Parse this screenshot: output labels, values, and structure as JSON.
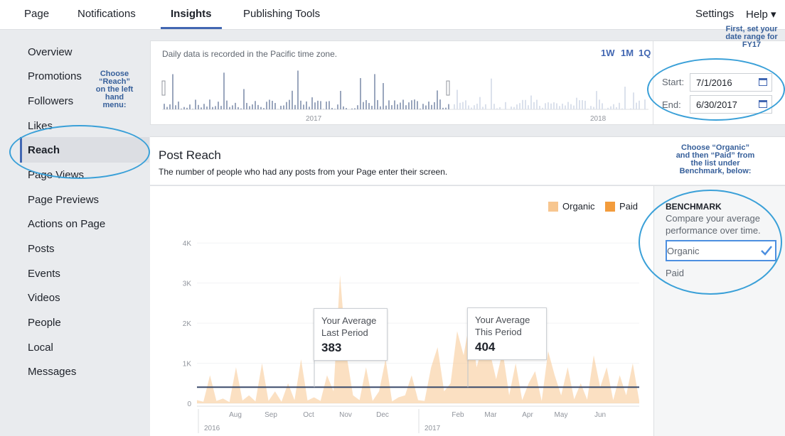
{
  "nav": {
    "page": "Page",
    "notifications": "Notifications",
    "insights": "Insights",
    "publishing_tools": "Publishing Tools",
    "settings": "Settings",
    "help": "Help ▾"
  },
  "sidebar": {
    "items": [
      "Overview",
      "Promotions",
      "Followers",
      "Likes",
      "Reach",
      "Page Views",
      "Page Previews",
      "Actions on Page",
      "Posts",
      "Events",
      "Videos",
      "People",
      "Local",
      "Messages"
    ],
    "active": "Reach"
  },
  "date_card": {
    "note": "Daily data is recorded in the Pacific time zone.",
    "range_buttons": [
      "1W",
      "1M",
      "1Q"
    ],
    "timeline_years": [
      "2017",
      "2018"
    ],
    "start_label": "Start:",
    "start_value": "7/1/2016",
    "end_label": "End:",
    "end_value": "6/30/2017"
  },
  "annotations": {
    "date_range": [
      "First, set your",
      "date range for",
      "FY17"
    ],
    "reach": [
      "Choose",
      "“Reach”",
      "on the left",
      "hand",
      "menu:"
    ],
    "benchmark": [
      "Choose “Organic”",
      "and then “Paid” from",
      "the list under",
      "Benchmark, below:"
    ]
  },
  "post_reach": {
    "title": "Post Reach",
    "subtitle": "The number of people who had any posts from your Page enter their screen."
  },
  "benchmark": {
    "heading": "BENCHMARK",
    "description_lines": [
      "Compare your average",
      "performance over time."
    ],
    "options": [
      "Organic",
      "Paid"
    ],
    "selected": "Organic"
  },
  "averages": {
    "last": {
      "label_lines": [
        "Your Average",
        "Last Period"
      ],
      "value": "383"
    },
    "this": {
      "label_lines": [
        "Your Average",
        "This Period"
      ],
      "value": "404"
    }
  },
  "chart_data": {
    "type": "area",
    "series": [
      {
        "name": "Organic",
        "color": "#f7c68f"
      },
      {
        "name": "Paid",
        "color": "#f39c3c"
      }
    ],
    "yticks": [
      "0",
      "1K",
      "2K",
      "3K",
      "4K"
    ],
    "ylim": [
      0,
      4500
    ],
    "xticks": [
      "Aug",
      "Sep",
      "Oct",
      "Nov",
      "Dec",
      "Feb",
      "Mar",
      "Apr",
      "May",
      "Jun"
    ],
    "year_labels": [
      "2016",
      "2017"
    ],
    "average_line": 404,
    "organic_values": [
      80,
      40,
      700,
      60,
      120,
      30,
      900,
      70,
      200,
      50,
      1000,
      60,
      300,
      40,
      500,
      80,
      1100,
      70,
      150,
      60,
      700,
      300,
      3200,
      1200,
      200,
      80,
      900,
      60,
      300,
      1100,
      50,
      150,
      200,
      700,
      80,
      60,
      900,
      1400,
      300,
      500,
      1800,
      1200,
      2100,
      900,
      1500,
      1300,
      600,
      1300,
      200,
      1000,
      80,
      500,
      800,
      60,
      1300,
      700,
      200,
      900,
      100,
      500,
      90,
      1200,
      400,
      900,
      80,
      700,
      200,
      1000,
      60
    ]
  }
}
